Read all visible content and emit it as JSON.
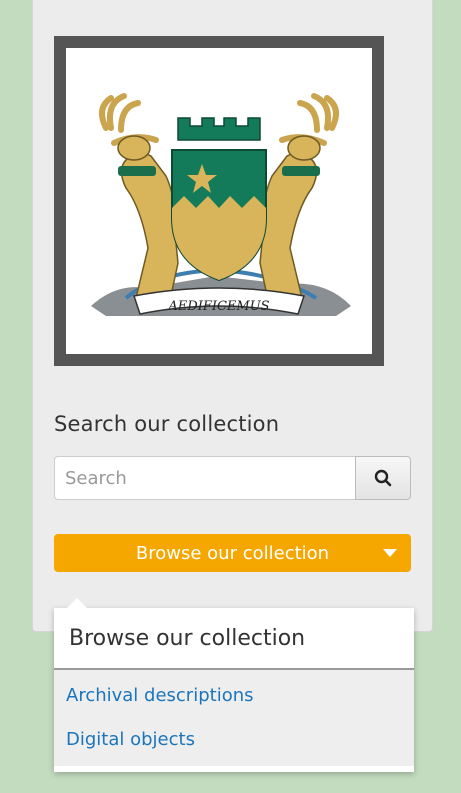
{
  "logo": {
    "motto": "AEDIFICEMUS",
    "colors": {
      "frame": "#555555",
      "shield_green": "#137a5a",
      "gold": "#d8b45a",
      "star": "#d8b45a"
    }
  },
  "search": {
    "heading": "Search our collection",
    "placeholder": "Search",
    "button_icon": "search-icon"
  },
  "browse": {
    "button_label": "Browse our collection",
    "button_color": "#f5a700",
    "caret_icon": "caret-down-icon",
    "dropdown": {
      "header": "Browse our collection",
      "items": [
        {
          "label": "Archival descriptions"
        },
        {
          "label": "Digital objects"
        }
      ],
      "link_color": "#1b75bb"
    }
  }
}
